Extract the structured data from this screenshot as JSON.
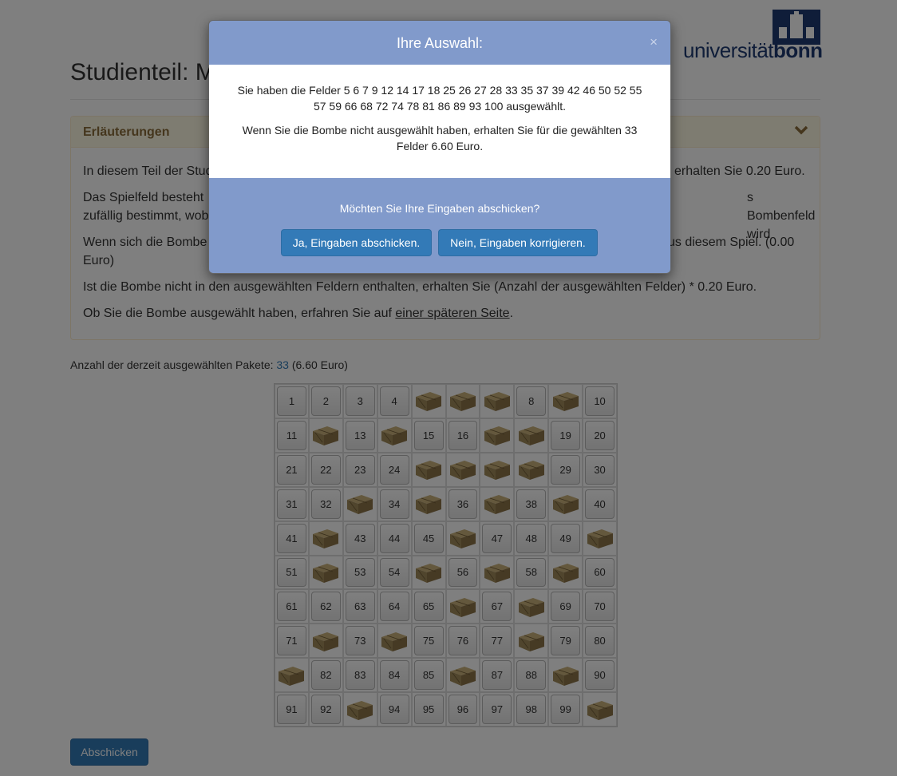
{
  "logo": {
    "text_regular": "universität",
    "text_bold": "bonn"
  },
  "page": {
    "title": "Studienteil: M"
  },
  "panel": {
    "title": "Erläuterungen",
    "paragraphs": [
      {
        "left": "In diesem Teil der Stud",
        "right": "erhalten Sie 0.20 Euro."
      },
      {
        "left": "Das Spielfeld besteht",
        "right": "s Bombenfeld wird",
        "line2": "zufällig bestimmt, wob"
      },
      {
        "left": "Wenn sich die Bombe",
        "right": "us diesem Spiel. (0.00",
        "line2": "Euro)"
      }
    ],
    "p4": "Ist die Bombe nicht in den ausgewählten Feldern enthalten, erhalten Sie (Anzahl der ausgewählten Felder) * 0.20 Euro.",
    "p5_before": "Ob Sie die Bombe ausgewählt haben, erfahren Sie auf ",
    "p5_link": "einer späteren Seite",
    "p5_after": "."
  },
  "count": {
    "label": "Anzahl der derzeit ausgewählten Pakete: ",
    "value": "33",
    "euro": " (6.60 Euro)"
  },
  "grid": {
    "selected": [
      5,
      6,
      7,
      9,
      12,
      14,
      17,
      18,
      25,
      26,
      27,
      28,
      33,
      35,
      37,
      39,
      42,
      46,
      50,
      52,
      55,
      57,
      59,
      66,
      68,
      72,
      74,
      78,
      81,
      86,
      89,
      93,
      100
    ],
    "package_color": "#a08a5a"
  },
  "submit": {
    "label": "Abschicken"
  },
  "modal": {
    "title": "Ihre Auswahl:",
    "close": "×",
    "line1": "Sie haben die Felder 5 6 7 9 12 14 17 18 25 26 27 28 33 35 37 39 42 46 50 52 55",
    "line2": "57 59 66 68 72 74 78 81 86 89 93 100 ausgewählt.",
    "line3": "Wenn Sie die Bombe nicht ausgewählt haben, erhalten Sie für die gewählten 33",
    "line4": "Felder 6.60 Euro.",
    "question": "Möchten Sie Ihre Eingaben abschicken?",
    "yes": "Ja, Eingaben abschicken.",
    "no": "Nein, Eingaben korrigieren."
  },
  "colors": {
    "primary": "#337ab7",
    "modal_header": "#819acb",
    "panel_warning": "#fcf8e3",
    "logo_blue": "#1f3b73"
  }
}
